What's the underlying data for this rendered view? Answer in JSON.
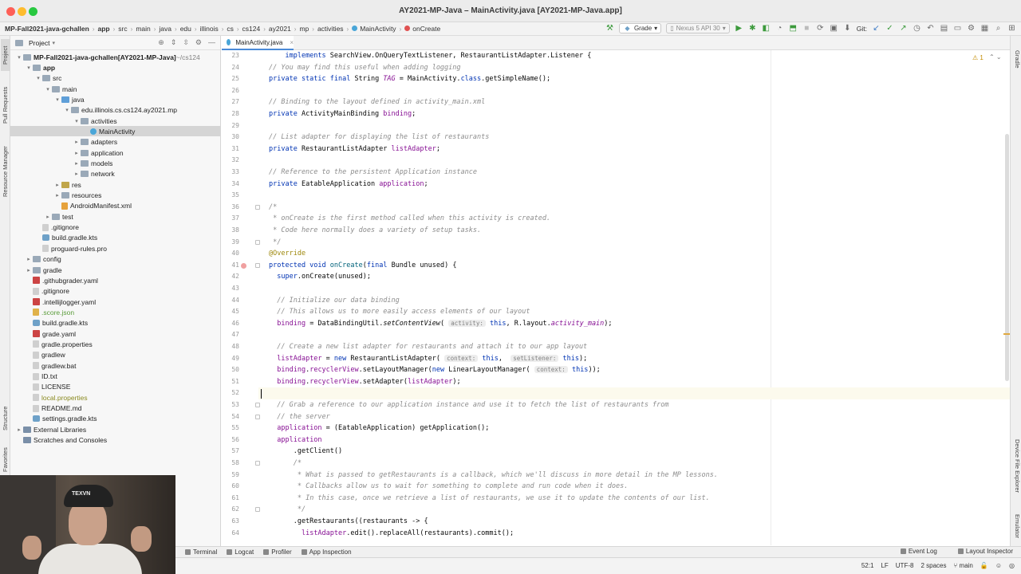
{
  "window": {
    "title": "AY2021-MP-Java – MainActivity.java [AY2021-MP-Java.app]"
  },
  "breadcrumbs": [
    "MP-Fall2021-java-gchallen",
    "app",
    "src",
    "main",
    "java",
    "edu",
    "illinois",
    "cs",
    "cs124",
    "ay2021",
    "mp",
    "activities",
    "MainActivity",
    "onCreate"
  ],
  "toolbar": {
    "run_config": "Grade",
    "device": "Nexus 5 API 30",
    "git_label": "Git:"
  },
  "left_strip": [
    "Project",
    "Pull Requests",
    "Resource Manager",
    "Structure",
    "Favorites"
  ],
  "right_strip": [
    "Gradle",
    "Device File Explorer",
    "Emulator"
  ],
  "project_panel": {
    "title": "Project",
    "tree": [
      {
        "label": "MP-Fall2021-java-gchallen",
        "suffix": " [AY2021-MP-Java]",
        "path": " ~/cs124",
        "indent": 0,
        "arrow": "▾",
        "icon": "folder",
        "bold": true
      },
      {
        "label": "app",
        "indent": 1,
        "arrow": "▾",
        "icon": "folder",
        "bold": true
      },
      {
        "label": "src",
        "indent": 2,
        "arrow": "▾",
        "icon": "folder"
      },
      {
        "label": "main",
        "indent": 3,
        "arrow": "▾",
        "icon": "folder"
      },
      {
        "label": "java",
        "indent": 4,
        "arrow": "▾",
        "icon": "folder-src"
      },
      {
        "label": "edu.illinois.cs.cs124.ay2021.mp",
        "indent": 5,
        "arrow": "▾",
        "icon": "folder"
      },
      {
        "label": "activities",
        "indent": 6,
        "arrow": "▾",
        "icon": "folder"
      },
      {
        "label": "MainActivity",
        "indent": 7,
        "arrow": "",
        "icon": "cls",
        "selected": true
      },
      {
        "label": "adapters",
        "indent": 6,
        "arrow": "▸",
        "icon": "folder"
      },
      {
        "label": "application",
        "indent": 6,
        "arrow": "▸",
        "icon": "folder"
      },
      {
        "label": "models",
        "indent": 6,
        "arrow": "▸",
        "icon": "folder"
      },
      {
        "label": "network",
        "indent": 6,
        "arrow": "▸",
        "icon": "folder"
      },
      {
        "label": "res",
        "indent": 4,
        "arrow": "▸",
        "icon": "folder-res"
      },
      {
        "label": "resources",
        "indent": 4,
        "arrow": "▸",
        "icon": "folder"
      },
      {
        "label": "AndroidManifest.xml",
        "indent": 4,
        "arrow": "",
        "icon": "xml"
      },
      {
        "label": "test",
        "indent": 3,
        "arrow": "▸",
        "icon": "folder"
      },
      {
        "label": ".gitignore",
        "indent": 2,
        "arrow": "",
        "icon": "file"
      },
      {
        "label": "build.gradle.kts",
        "indent": 2,
        "arrow": "",
        "icon": "gradle"
      },
      {
        "label": "proguard-rules.pro",
        "indent": 2,
        "arrow": "",
        "icon": "file"
      },
      {
        "label": "config",
        "indent": 1,
        "arrow": "▸",
        "icon": "folder"
      },
      {
        "label": "gradle",
        "indent": 1,
        "arrow": "▸",
        "icon": "folder"
      },
      {
        "label": ".githubgrader.yaml",
        "indent": 1,
        "arrow": "",
        "icon": "yaml"
      },
      {
        "label": ".gitignore",
        "indent": 1,
        "arrow": "",
        "icon": "file"
      },
      {
        "label": ".intellijlogger.yaml",
        "indent": 1,
        "arrow": "",
        "icon": "yaml"
      },
      {
        "label": ".score.json",
        "indent": 1,
        "arrow": "",
        "icon": "json",
        "color": "green"
      },
      {
        "label": "build.gradle.kts",
        "indent": 1,
        "arrow": "",
        "icon": "gradle"
      },
      {
        "label": "grade.yaml",
        "indent": 1,
        "arrow": "",
        "icon": "yaml"
      },
      {
        "label": "gradle.properties",
        "indent": 1,
        "arrow": "",
        "icon": "file"
      },
      {
        "label": "gradlew",
        "indent": 1,
        "arrow": "",
        "icon": "file"
      },
      {
        "label": "gradlew.bat",
        "indent": 1,
        "arrow": "",
        "icon": "file"
      },
      {
        "label": "ID.txt",
        "indent": 1,
        "arrow": "",
        "icon": "file"
      },
      {
        "label": "LICENSE",
        "indent": 1,
        "arrow": "",
        "icon": "file"
      },
      {
        "label": "local.properties",
        "indent": 1,
        "arrow": "",
        "icon": "file",
        "color": "olive"
      },
      {
        "label": "README.md",
        "indent": 1,
        "arrow": "",
        "icon": "file"
      },
      {
        "label": "settings.gradle.kts",
        "indent": 1,
        "arrow": "",
        "icon": "gradle"
      },
      {
        "label": "External Libraries",
        "indent": 0,
        "arrow": "▸",
        "icon": "lib"
      },
      {
        "label": "Scratches and Consoles",
        "indent": 0,
        "arrow": "",
        "icon": "lib"
      }
    ]
  },
  "editor": {
    "tab_label": "MainActivity.java",
    "warning_count": "1",
    "current_line": 52,
    "lines": [
      {
        "n": 23,
        "tokens": [
          [
            "",
            "    "
          ],
          [
            "kw",
            "implements"
          ],
          [
            "",
            " SearchView.OnQueryTextListener, RestaurantListAdapter.Listener {"
          ]
        ]
      },
      {
        "n": 24,
        "tokens": [
          [
            "cm",
            "// You may find this useful when adding logging"
          ]
        ]
      },
      {
        "n": 25,
        "tokens": [
          [
            "kw",
            "private static final"
          ],
          [
            "",
            " String "
          ],
          [
            "fld itl",
            "TAG"
          ],
          [
            "",
            " = MainActivity."
          ],
          [
            "kw",
            "class"
          ],
          [
            "",
            ".getSimpleName();"
          ]
        ]
      },
      {
        "n": 26,
        "tokens": []
      },
      {
        "n": 27,
        "tokens": [
          [
            "cm",
            "// Binding to the layout defined in activity_main.xml"
          ]
        ]
      },
      {
        "n": 28,
        "tokens": [
          [
            "kw",
            "private"
          ],
          [
            "",
            " ActivityMainBinding "
          ],
          [
            "fld",
            "binding"
          ],
          [
            "",
            ";"
          ]
        ]
      },
      {
        "n": 29,
        "tokens": []
      },
      {
        "n": 30,
        "tokens": [
          [
            "cm",
            "// List adapter for displaying the list of restaurants"
          ]
        ]
      },
      {
        "n": 31,
        "tokens": [
          [
            "kw",
            "private"
          ],
          [
            "",
            " RestaurantListAdapter "
          ],
          [
            "fld",
            "listAdapter"
          ],
          [
            "",
            ";"
          ]
        ]
      },
      {
        "n": 32,
        "tokens": []
      },
      {
        "n": 33,
        "tokens": [
          [
            "cm",
            "// Reference to the persistent Application instance"
          ]
        ]
      },
      {
        "n": 34,
        "tokens": [
          [
            "kw",
            "private"
          ],
          [
            "",
            " EatableApplication "
          ],
          [
            "fld",
            "application"
          ],
          [
            "",
            ";"
          ]
        ]
      },
      {
        "n": 35,
        "tokens": []
      },
      {
        "n": 36,
        "tokens": [
          [
            "cm",
            "/*"
          ]
        ]
      },
      {
        "n": 37,
        "tokens": [
          [
            "cm",
            " * onCreate is the first method called when this activity is created."
          ]
        ]
      },
      {
        "n": 38,
        "tokens": [
          [
            "cm",
            " * Code here normally does a variety of setup tasks."
          ]
        ]
      },
      {
        "n": 39,
        "tokens": [
          [
            "cm",
            " */"
          ]
        ]
      },
      {
        "n": 40,
        "tokens": [
          [
            "ann",
            "@Override"
          ]
        ]
      },
      {
        "n": 41,
        "tokens": [
          [
            "kw",
            "protected void"
          ],
          [
            "",
            " "
          ],
          [
            "fn",
            "onCreate"
          ],
          [
            "",
            "("
          ],
          [
            "kw",
            "final"
          ],
          [
            "",
            " Bundle unused) {"
          ]
        ]
      },
      {
        "n": 42,
        "tokens": [
          [
            "",
            "  "
          ],
          [
            "kw",
            "super"
          ],
          [
            "",
            ".onCreate(unused);"
          ]
        ]
      },
      {
        "n": 43,
        "tokens": []
      },
      {
        "n": 44,
        "tokens": [
          [
            "",
            "  "
          ],
          [
            "cm",
            "// Initialize our data binding"
          ]
        ]
      },
      {
        "n": 45,
        "tokens": [
          [
            "",
            "  "
          ],
          [
            "cm",
            "// This allows us to more easily access elements of our layout"
          ]
        ]
      },
      {
        "n": 46,
        "tokens": [
          [
            "",
            "  "
          ],
          [
            "fld",
            "binding"
          ],
          [
            "",
            " = DataBindingUtil."
          ],
          [
            "itl",
            "setContentView"
          ],
          [
            "",
            "( "
          ],
          [
            "hint",
            "activity:"
          ],
          [
            "",
            " "
          ],
          [
            "kw",
            "this"
          ],
          [
            "",
            ", R.layout."
          ],
          [
            "fld itl",
            "activity_main"
          ],
          [
            "",
            ");"
          ]
        ]
      },
      {
        "n": 47,
        "tokens": []
      },
      {
        "n": 48,
        "tokens": [
          [
            "",
            "  "
          ],
          [
            "cm",
            "// Create a new list adapter for restaurants and attach it to our app layout"
          ]
        ]
      },
      {
        "n": 49,
        "tokens": [
          [
            "",
            "  "
          ],
          [
            "fld",
            "listAdapter"
          ],
          [
            "",
            " = "
          ],
          [
            "kw",
            "new"
          ],
          [
            "",
            " RestaurantListAdapter( "
          ],
          [
            "hint",
            "context:"
          ],
          [
            "",
            " "
          ],
          [
            "kw",
            "this"
          ],
          [
            "",
            ",  "
          ],
          [
            "hint",
            "setListener:"
          ],
          [
            "",
            " "
          ],
          [
            "kw",
            "this"
          ],
          [
            "",
            ");"
          ]
        ]
      },
      {
        "n": 50,
        "tokens": [
          [
            "",
            "  "
          ],
          [
            "fld",
            "binding"
          ],
          [
            "",
            "."
          ],
          [
            "fld",
            "recyclerView"
          ],
          [
            "",
            ".setLayoutManager("
          ],
          [
            "kw",
            "new"
          ],
          [
            "",
            " LinearLayoutManager( "
          ],
          [
            "hint",
            "context:"
          ],
          [
            "",
            " "
          ],
          [
            "kw",
            "this"
          ],
          [
            "",
            "));"
          ]
        ]
      },
      {
        "n": 51,
        "tokens": [
          [
            "",
            "  "
          ],
          [
            "fld",
            "binding"
          ],
          [
            "",
            "."
          ],
          [
            "fld",
            "recyclerView"
          ],
          [
            "",
            ".setAdapter("
          ],
          [
            "fld",
            "listAdapter"
          ],
          [
            "",
            ");"
          ]
        ]
      },
      {
        "n": 52,
        "tokens": []
      },
      {
        "n": 53,
        "tokens": [
          [
            "",
            "  "
          ],
          [
            "cm",
            "// Grab a reference to our application instance and use it to fetch the list of restaurants from"
          ]
        ]
      },
      {
        "n": 54,
        "tokens": [
          [
            "",
            "  "
          ],
          [
            "cm",
            "// the server"
          ]
        ]
      },
      {
        "n": 55,
        "tokens": [
          [
            "",
            "  "
          ],
          [
            "fld",
            "application"
          ],
          [
            "",
            " = (EatableApplication) getApplication();"
          ]
        ]
      },
      {
        "n": 56,
        "tokens": [
          [
            "",
            "  "
          ],
          [
            "fld",
            "application"
          ]
        ]
      },
      {
        "n": 57,
        "tokens": [
          [
            "",
            "      .getClient()"
          ]
        ]
      },
      {
        "n": 58,
        "tokens": [
          [
            "",
            "      "
          ],
          [
            "cm",
            "/*"
          ]
        ]
      },
      {
        "n": 59,
        "tokens": [
          [
            "",
            "      "
          ],
          [
            "cm",
            " * What is passed to getRestaurants is a callback, which we'll discuss in more detail in the MP lessons."
          ]
        ]
      },
      {
        "n": 60,
        "tokens": [
          [
            "",
            "      "
          ],
          [
            "cm",
            " * Callbacks allow us to wait for something to complete and run code when it does."
          ]
        ]
      },
      {
        "n": 61,
        "tokens": [
          [
            "",
            "      "
          ],
          [
            "cm",
            " * In this case, once we retrieve a list of restaurants, we use it to update the contents of our list."
          ]
        ]
      },
      {
        "n": 62,
        "tokens": [
          [
            "",
            "      "
          ],
          [
            "cm",
            " */"
          ]
        ]
      },
      {
        "n": 63,
        "tokens": [
          [
            "",
            "      .getRestaurants((restaurants -> {"
          ]
        ]
      },
      {
        "n": 64,
        "tokens": [
          [
            "",
            "        "
          ],
          [
            "fld",
            "listAdapter"
          ],
          [
            "",
            ".edit().replaceAll(restaurants).commit();"
          ]
        ]
      }
    ]
  },
  "bottom_tools": [
    "Terminal",
    "Logcat",
    "Profiler",
    "App Inspection"
  ],
  "bottom_right_tools": [
    "Event Log",
    "Layout Inspector"
  ],
  "status": {
    "position": "52:1",
    "line_sep": "LF",
    "encoding": "UTF-8",
    "indent": "2 spaces",
    "branch": "main"
  },
  "webcam": {
    "cap_text": "TEXVN"
  }
}
